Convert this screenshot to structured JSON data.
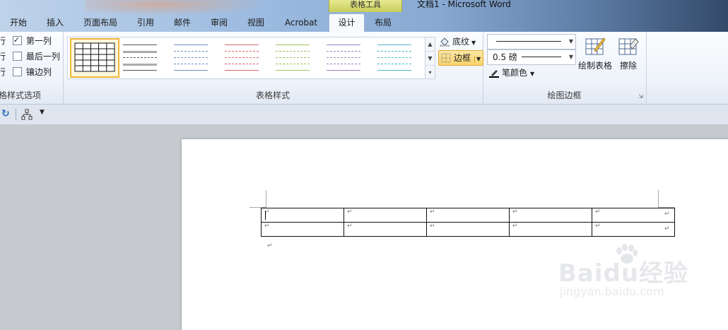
{
  "window": {
    "title": "文档1  -  Microsoft Word"
  },
  "context_group": {
    "label": "表格工具"
  },
  "tabs": [
    {
      "label": "开始"
    },
    {
      "label": "插入"
    },
    {
      "label": "页面布局"
    },
    {
      "label": "引用"
    },
    {
      "label": "邮件"
    },
    {
      "label": "审阅"
    },
    {
      "label": "视图"
    },
    {
      "label": "Acrobat"
    },
    {
      "label": "设计",
      "active": true
    },
    {
      "label": "布局"
    }
  ],
  "style_options": {
    "rows": [
      {
        "label": "第一列",
        "checked": true,
        "cut": "行"
      },
      {
        "label": "最后一列",
        "checked": false,
        "cut": "行"
      },
      {
        "label": "镶边列",
        "checked": false,
        "cut": "行"
      }
    ],
    "group_label": "格样式选项"
  },
  "table_styles": {
    "group_label": "表格样式",
    "swatch_colors": [
      "#222222",
      "#555555",
      "#6f8fc8",
      "#d9686b",
      "#9cc25a",
      "#9b83c4",
      "#4fb6c9"
    ]
  },
  "shading": {
    "label": "底纹"
  },
  "borders": {
    "label": "边框"
  },
  "draw_borders": {
    "weight": "0.5 磅",
    "pen_color_label": "笔颜色",
    "draw_table_label": "绘制表格",
    "eraser_label": "擦除",
    "group_label": "绘图边框"
  },
  "document": {
    "cell_mark": "↵",
    "paragraph_mark": "↵",
    "rows": 2,
    "cols": 5
  },
  "watermark": {
    "brand": "Baidu经验",
    "url": "jingyan.baidu.com"
  }
}
